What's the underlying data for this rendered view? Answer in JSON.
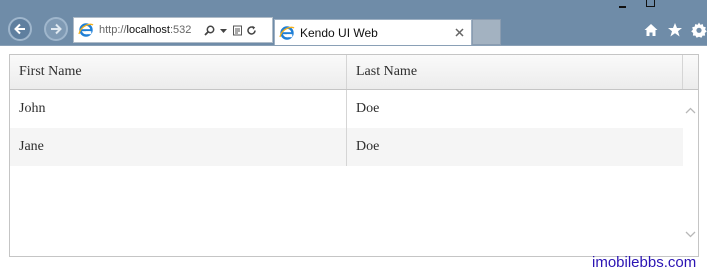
{
  "browser": {
    "address": {
      "scheme": "http://",
      "host": "localhost",
      "port": ":532"
    },
    "tab": {
      "title": "Kendo UI Web"
    }
  },
  "grid": {
    "columns": [
      "First Name",
      "Last Name"
    ],
    "rows": [
      {
        "first": "John",
        "last": "Doe"
      },
      {
        "first": "Jane",
        "last": "Doe"
      }
    ]
  },
  "watermark": "imobilebbs.com"
}
